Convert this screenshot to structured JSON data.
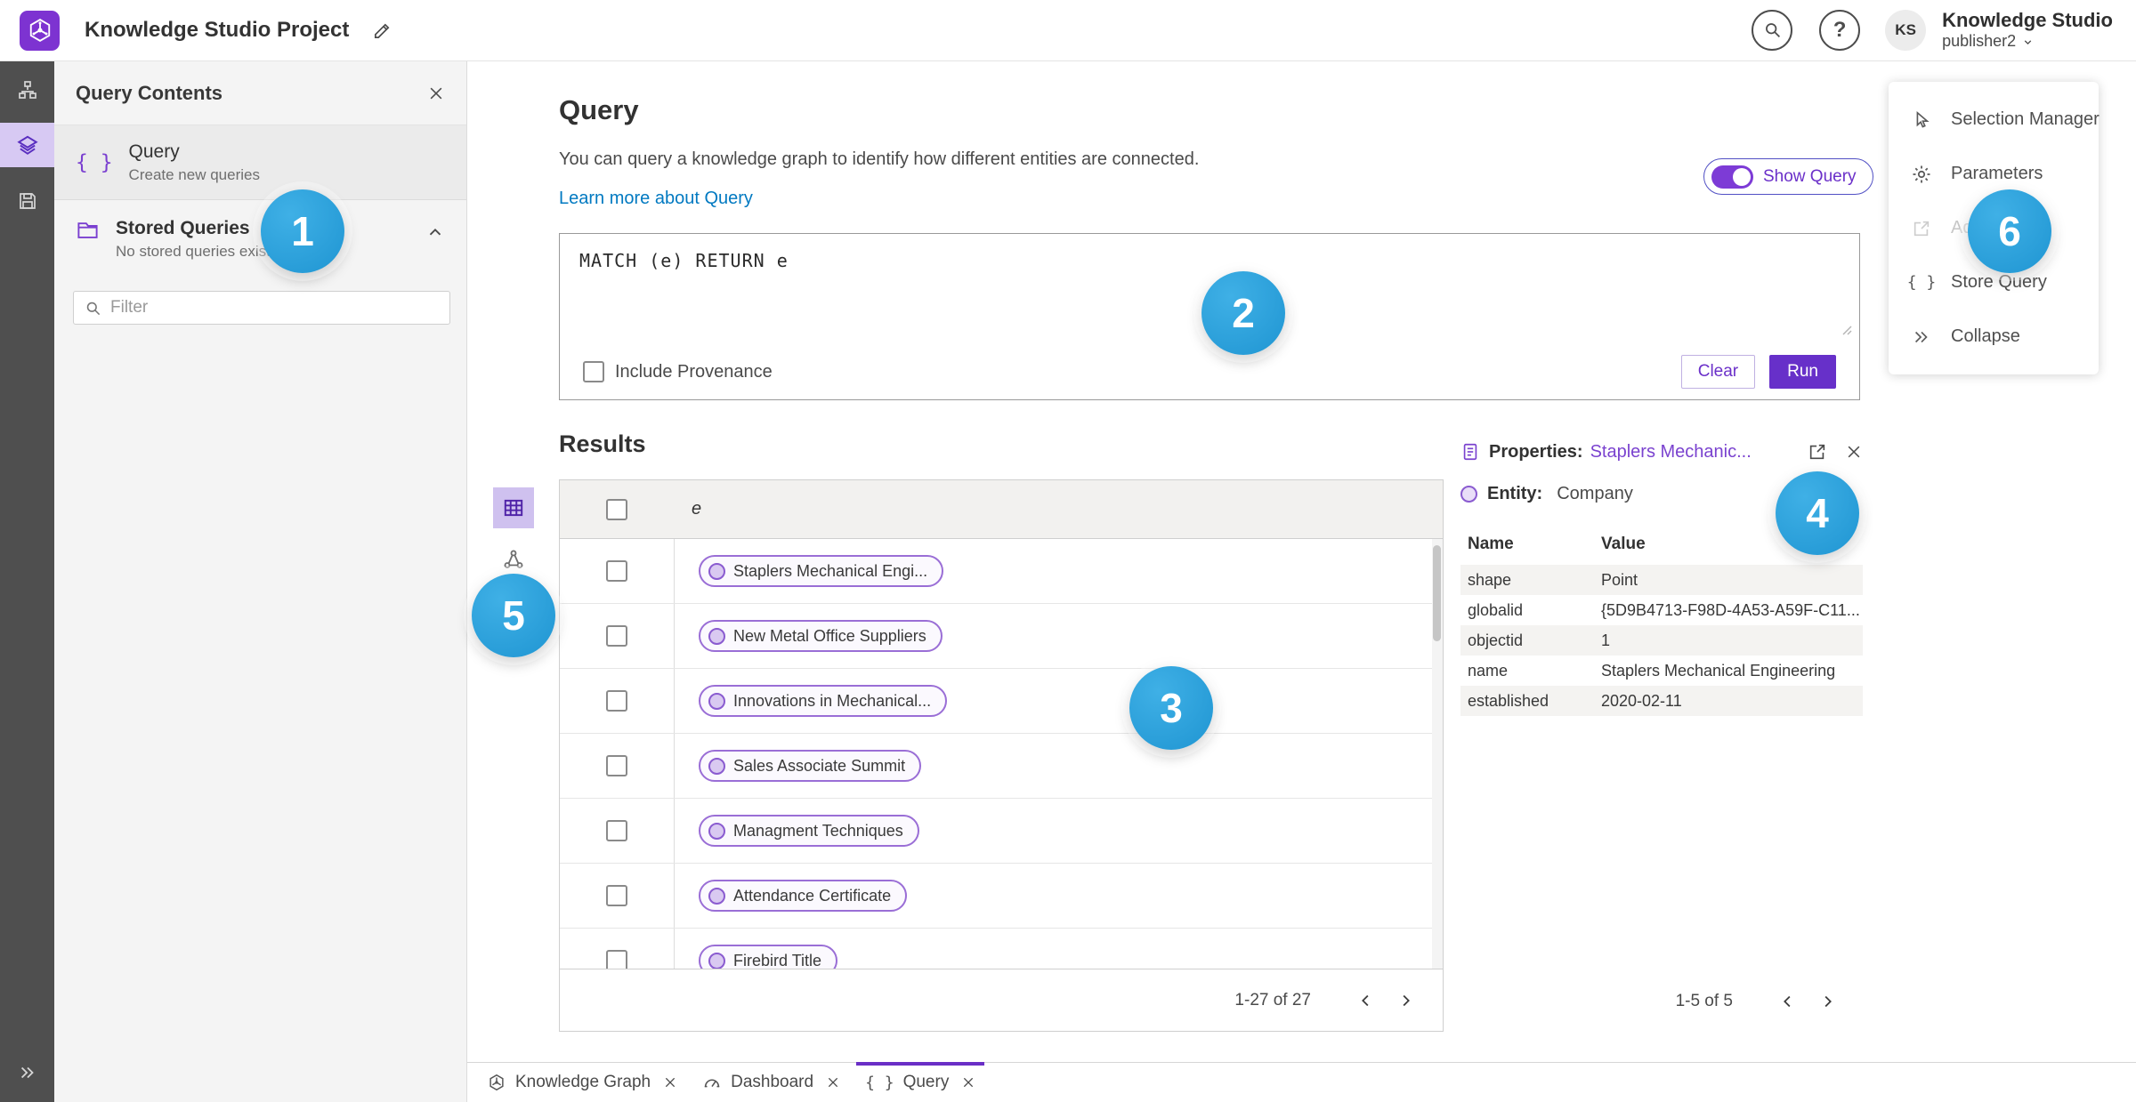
{
  "header": {
    "title": "Knowledge Studio Project",
    "avatar_initials": "KS",
    "user_name": "Knowledge Studio",
    "user_role": "publisher2"
  },
  "left_panel": {
    "title": "Query Contents",
    "query_item": {
      "label": "Query",
      "sublabel": "Create new queries"
    },
    "stored_queries": {
      "label": "Stored Queries",
      "sublabel": "No stored queries exist"
    },
    "filter_placeholder": "Filter"
  },
  "main": {
    "title": "Query",
    "description": "You can query a knowledge graph to identify how different entities are connected.",
    "learn_more_label": "Learn more about Query",
    "show_query_label": "Show Query",
    "query_text": "MATCH (e) RETURN e",
    "include_provenance_label": "Include Provenance",
    "clear_label": "Clear",
    "run_label": "Run"
  },
  "results": {
    "title": "Results",
    "column_header": "e",
    "rows": [
      "Staplers Mechanical Engi...",
      "New Metal Office Suppliers",
      "Innovations in Mechanical...",
      "Sales Associate Summit",
      "Managment Techniques",
      "Attendance Certificate",
      "Firebird Title"
    ],
    "pagination": "1-27 of 27"
  },
  "properties": {
    "title": "Properties:",
    "entity_link": "Staplers Mechanic...",
    "entity_label": "Entity:",
    "entity_value": "Company",
    "name_header": "Name",
    "value_header": "Value",
    "rows": [
      {
        "name": "shape",
        "value": "Point"
      },
      {
        "name": "globalid",
        "value": "{5D9B4713-F98D-4A53-A59F-C11..."
      },
      {
        "name": "objectid",
        "value": "1"
      },
      {
        "name": "name",
        "value": "Staplers Mechanical Engineering"
      },
      {
        "name": "established",
        "value": "2020-02-11"
      }
    ],
    "pagination": "1-5 of 5"
  },
  "tools": {
    "items": [
      {
        "label": "Selection Manager"
      },
      {
        "label": "Parameters"
      },
      {
        "label": "Add To Map"
      },
      {
        "label": "Store Query"
      },
      {
        "label": "Collapse"
      }
    ]
  },
  "tabs": [
    {
      "label": "Knowledge Graph"
    },
    {
      "label": "Dashboard"
    },
    {
      "label": "Query"
    }
  ],
  "badges": [
    "1",
    "2",
    "3",
    "4",
    "5",
    "6"
  ],
  "colors": {
    "accent_purple": "#7b3fd0",
    "run_button": "#6730c9",
    "badge_blue": "#2aa3de",
    "link_blue": "#0079c1"
  }
}
